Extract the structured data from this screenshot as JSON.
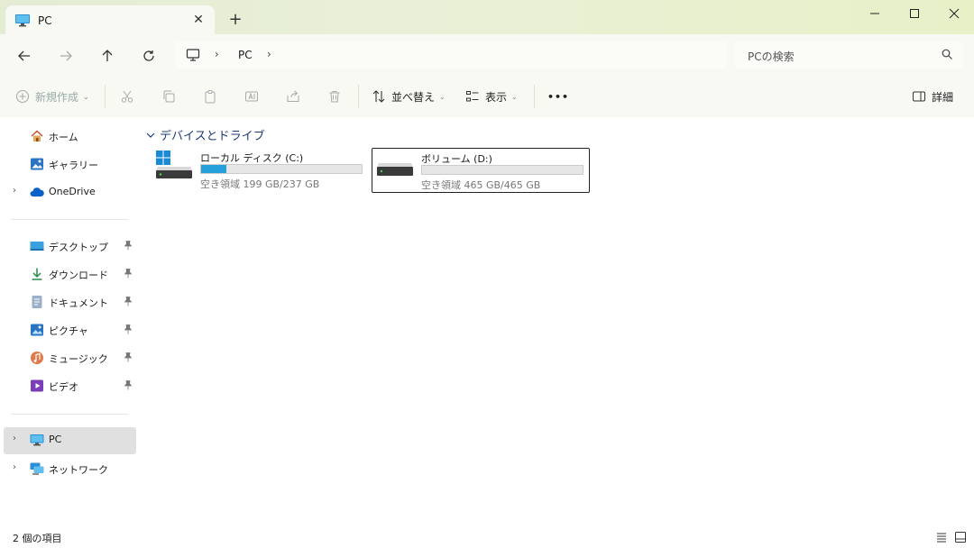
{
  "tab": {
    "title": "PC",
    "close": "✕",
    "new_tab": "+"
  },
  "window_buttons": [
    "minimize",
    "maximize",
    "close"
  ],
  "nav": {
    "back": "back-arrow",
    "forward": "forward-arrow",
    "up": "up-arrow",
    "refresh": "refresh"
  },
  "address": {
    "label": "PC",
    "sep": "›"
  },
  "search": {
    "placeholder": "PCの検索"
  },
  "toolbar": {
    "new": "新規作成",
    "sort": "並べ替え",
    "view": "表示",
    "more": "•••",
    "details": "詳細"
  },
  "sidebar": {
    "top": [
      {
        "label": "ホーム",
        "icon": "home-icon"
      },
      {
        "label": "ギャラリー",
        "icon": "gallery-icon"
      },
      {
        "label": "OneDrive",
        "icon": "onedrive-icon"
      }
    ],
    "pinned": [
      {
        "label": "デスクトップ",
        "icon": "desktop-icon"
      },
      {
        "label": "ダウンロード",
        "icon": "download-icon"
      },
      {
        "label": "ドキュメント",
        "icon": "document-icon"
      },
      {
        "label": "ピクチャ",
        "icon": "pictures-icon"
      },
      {
        "label": "ミュージック",
        "icon": "music-icon"
      },
      {
        "label": "ビデオ",
        "icon": "video-icon"
      }
    ],
    "bottom": [
      {
        "label": "PC",
        "icon": "pc-icon"
      },
      {
        "label": "ネットワーク",
        "icon": "network-icon"
      }
    ]
  },
  "main": {
    "group_header": "デバイスとドライブ",
    "drives": [
      {
        "name": "ローカル ディスク (C:)",
        "free_text": "空き領域 199 GB/237 GB",
        "used_fraction": 0.16
      },
      {
        "name": "ボリューム (D:)",
        "free_text": "空き領域 465 GB/465 GB",
        "used_fraction": 0.0
      }
    ]
  },
  "status": {
    "count": "2 個の項目"
  },
  "colors": {
    "accent": "#26a0da",
    "title_bg": "#e8f0d4",
    "header_text": "#1e3a78"
  }
}
